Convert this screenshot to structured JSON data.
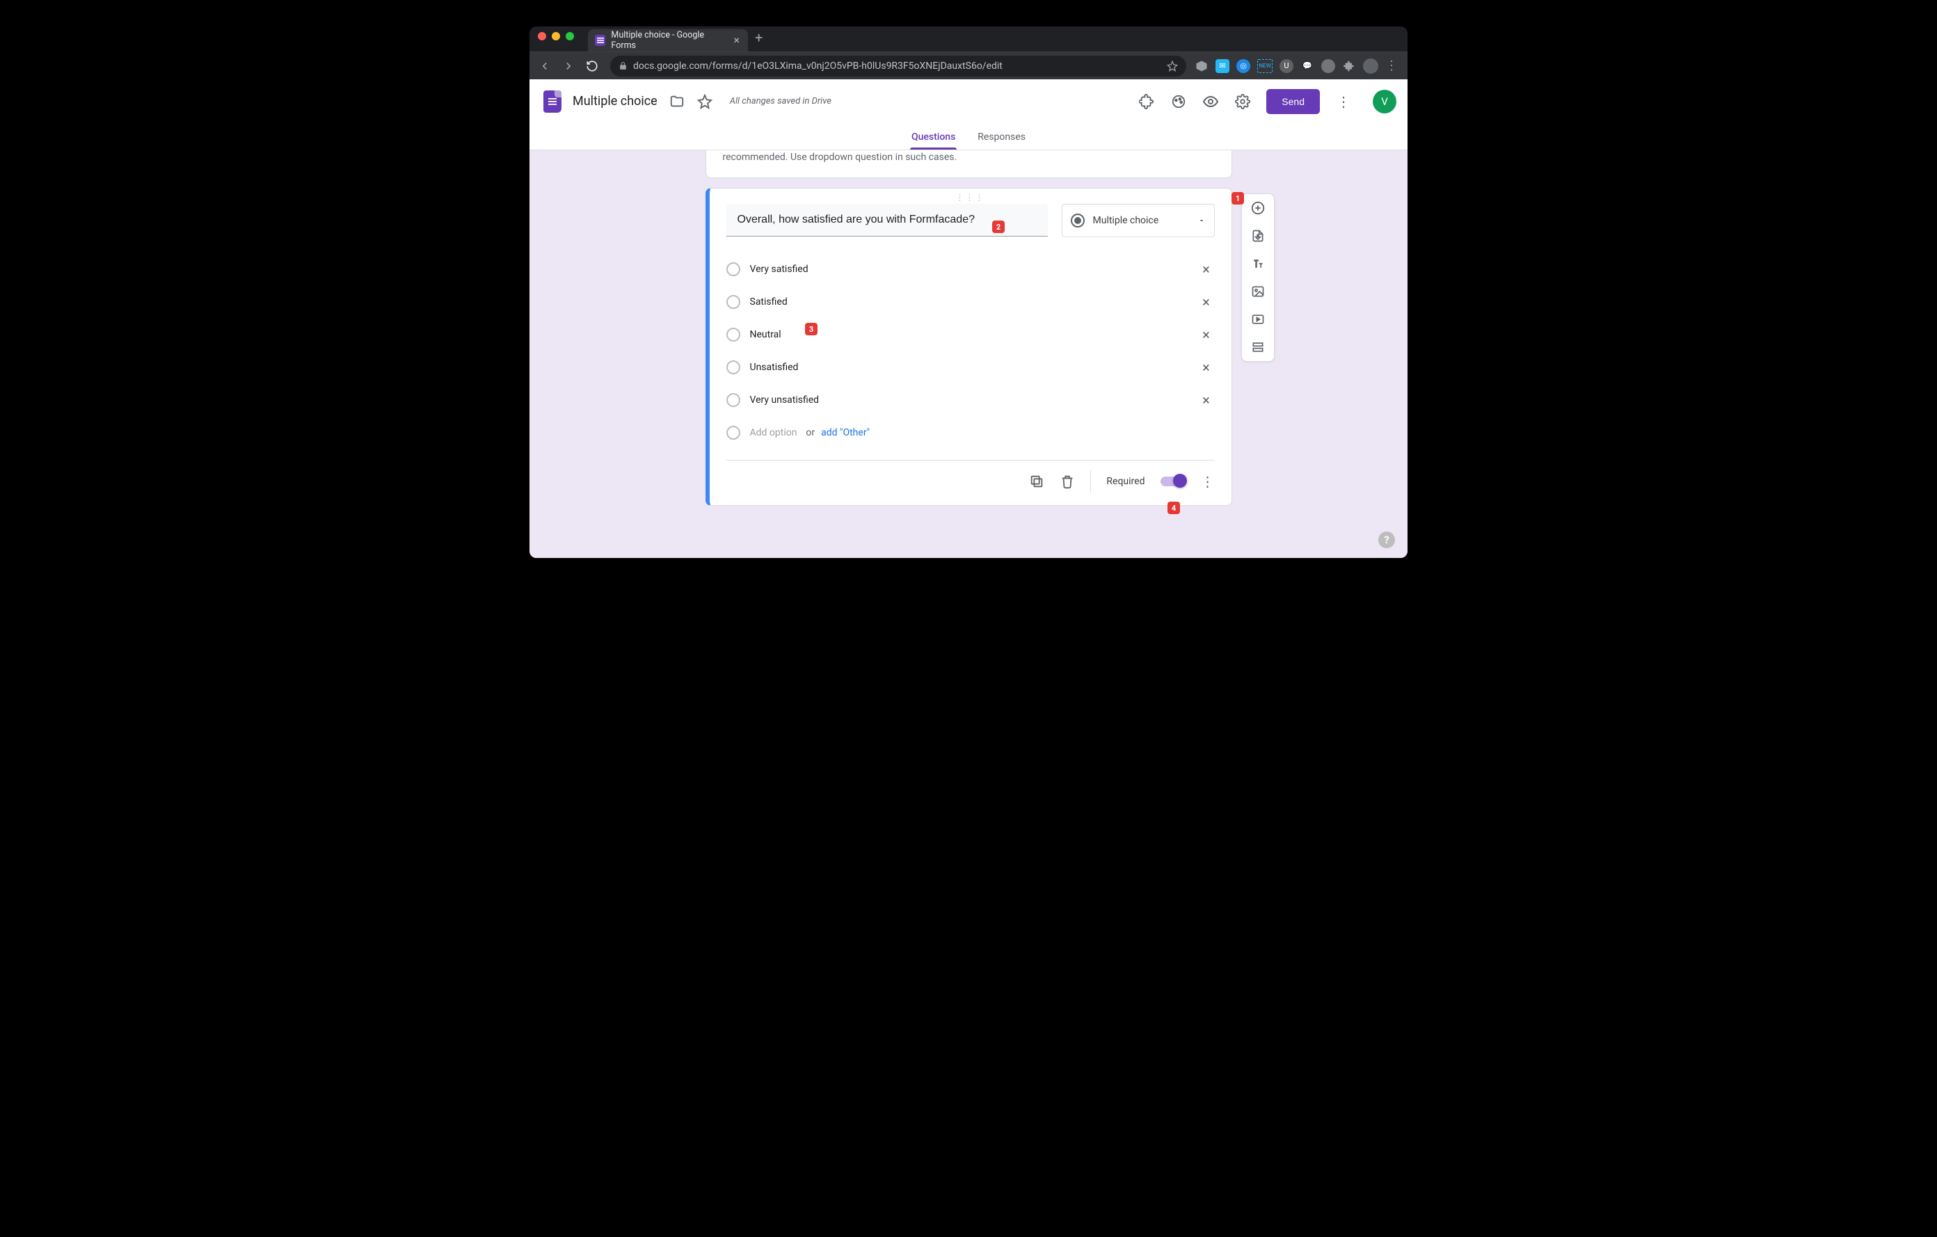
{
  "browser": {
    "tab_title": "Multiple choice - Google Forms",
    "url": "docs.google.com/forms/d/1eO3LXima_v0nj2O5vPB-h0lUs9R3F5oXNEjDauxtS6o/edit"
  },
  "header": {
    "title": "Multiple choice",
    "save_status": "All changes saved in Drive",
    "send_label": "Send",
    "avatar_letter": "V"
  },
  "tabs": {
    "questions": "Questions",
    "responses": "Responses"
  },
  "desc_tail": "recommended. Use dropdown question in such cases.",
  "question": {
    "text": "Overall, how satisfied are you with Formfacade?",
    "type_label": "Multiple choice",
    "options": [
      "Very satisfied",
      "Satisfied",
      "Neutral",
      "Unsatisfied",
      "Very unsatisfied"
    ],
    "add_option": "Add option",
    "or": "or",
    "add_other": "add \"Other\"",
    "required_label": "Required"
  },
  "callouts": {
    "c1": "1",
    "c2": "2",
    "c3": "3",
    "c4": "4"
  }
}
